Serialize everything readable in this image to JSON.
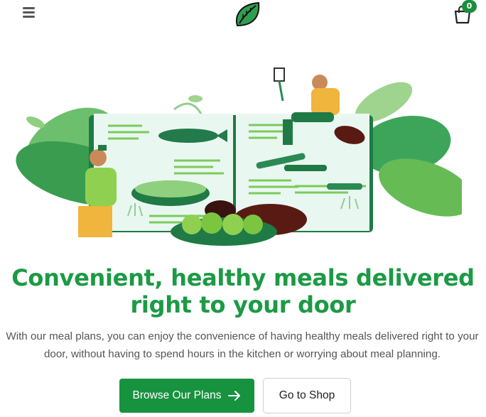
{
  "header": {
    "menu_icon": "hamburger-menu-icon",
    "logo_icon": "leaf-logo-icon",
    "cart_icon": "shopping-bag-icon",
    "cart_count": "0"
  },
  "hero": {
    "illustration": "meal-planning-illustration",
    "headline_line1": "Convenient, healthy meals delivered",
    "headline_line2": "right to your door",
    "subtext_line1": "With our meal plans, you can enjoy the convenience of having healthy meals delivered right to your",
    "subtext_line2": "door, without having to spend hours in the kitchen or worrying about meal planning.",
    "primary_button_label": "Browse Our Plans",
    "secondary_button_label": "Go to Shop"
  },
  "colors": {
    "brand_green": "#1c9a45",
    "button_green": "#17923f",
    "text_gray": "#555555"
  }
}
